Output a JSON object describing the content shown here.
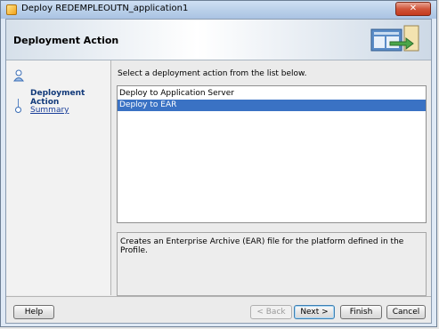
{
  "window": {
    "title": "Deploy REDEMPLEOUTN_application1",
    "close_glyph": "✕"
  },
  "header": {
    "title": "Deployment Action"
  },
  "nav": {
    "items": [
      {
        "label": "Deployment Action",
        "state": "current"
      },
      {
        "label": "Summary",
        "state": "link"
      }
    ]
  },
  "main": {
    "instruction": "Select a deployment action from the list below.",
    "actions": [
      {
        "label": "Deploy to Application Server",
        "selected": false
      },
      {
        "label": "Deploy to EAR",
        "selected": true
      }
    ],
    "description": "Creates an Enterprise Archive (EAR) file for the platform defined in the Profile."
  },
  "buttons": {
    "help": "Help",
    "back": "< Back",
    "next": "Next >",
    "finish": "Finish",
    "cancel": "Cancel"
  },
  "colors": {
    "selection": "#3a72c4",
    "close": "#c53a1e"
  }
}
